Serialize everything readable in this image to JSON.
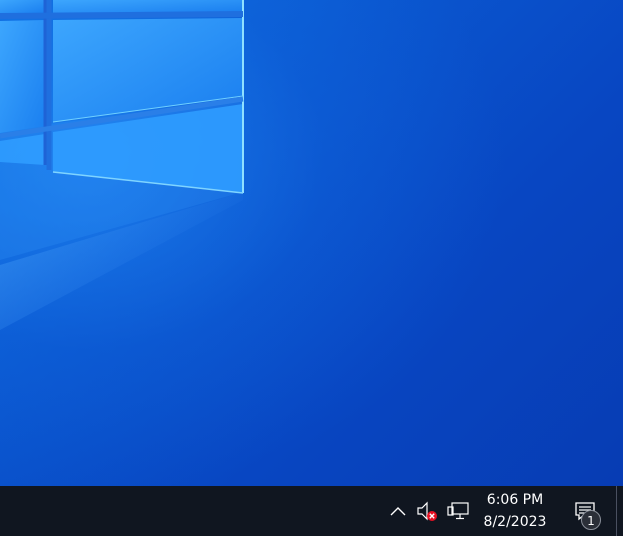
{
  "desktop": {
    "wallpaper": "windows-10-hero-wallpaper",
    "colors": {
      "background": "#0a4ec8",
      "pane_light": "#4fc2ff",
      "taskbar": "#101620"
    }
  },
  "taskbar": {
    "tray": {
      "show_hidden_icon": "chevron-up-icon",
      "volume_icon": "speaker-muted-icon",
      "network_icon": "ethernet-network-icon"
    },
    "clock": {
      "time": "6:06 PM",
      "date": "8/2/2023"
    },
    "notifications": {
      "icon": "action-center-icon",
      "count": "1"
    }
  }
}
